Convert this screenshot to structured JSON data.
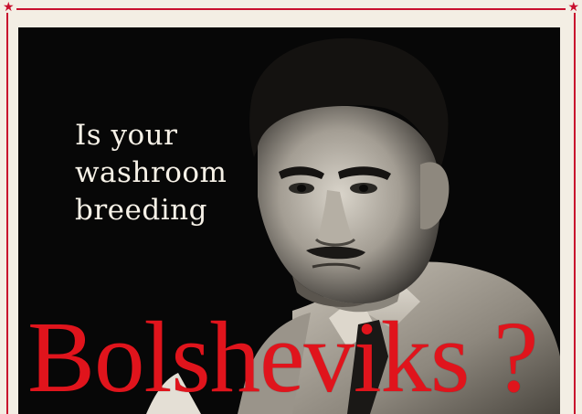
{
  "poster": {
    "question_lines": [
      "Is your",
      "washroom",
      "breeding"
    ],
    "headline": "Bolsheviks ?"
  },
  "colors": {
    "accent_red": "#e0141c",
    "background_black": "#070707",
    "paper": "#f3eee4",
    "question_text": "#f6f1e7"
  },
  "icons": {
    "border_star": "star-icon"
  }
}
